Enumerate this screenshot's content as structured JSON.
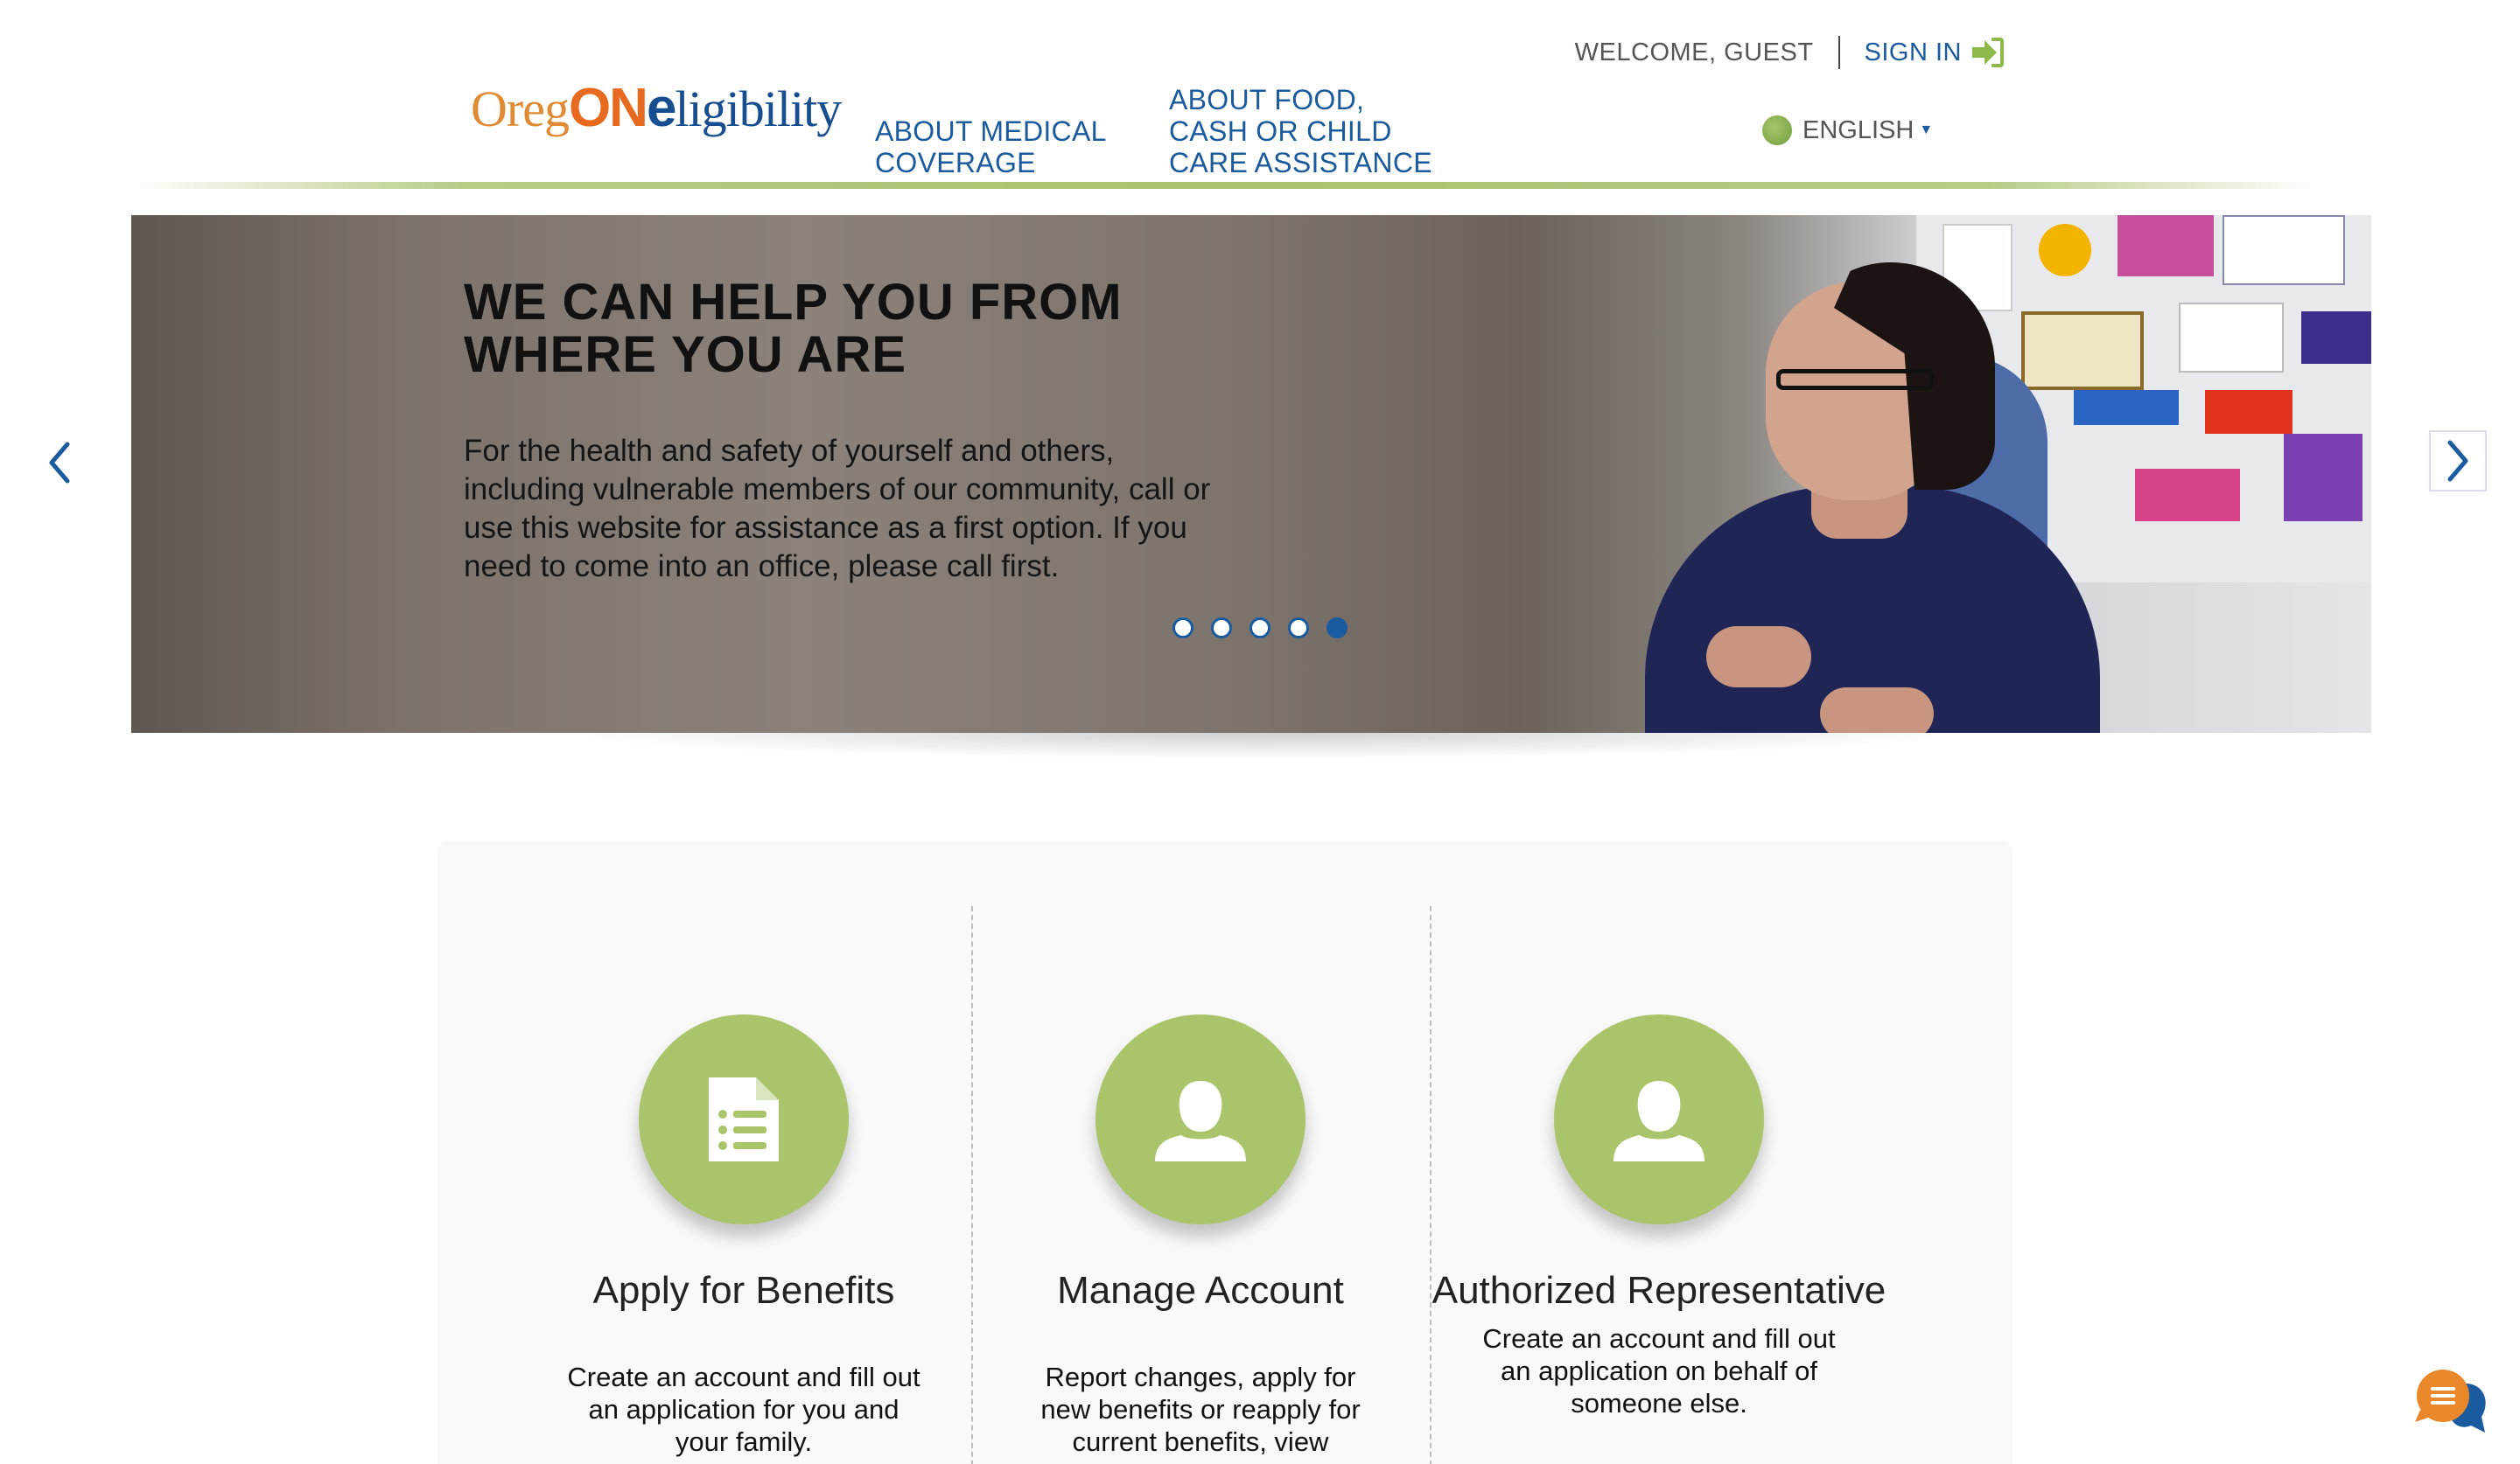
{
  "header": {
    "welcome": "WELCOME, GUEST",
    "signin": "SIGN IN",
    "logo": {
      "part1": "Oreg",
      "part2": "ON",
      "part3": "e",
      "part4": "ligibility"
    },
    "nav": {
      "medical": "ABOUT MEDICAL COVERAGE",
      "food": "ABOUT FOOD, CASH OR CHILD CARE ASSISTANCE"
    },
    "language": "ENGLISH"
  },
  "carousel": {
    "title": "WE CAN HELP YOU FROM WHERE YOU ARE",
    "body": "For the health and safety of yourself and others, including vulnerable members of our community, call or use this website for assistance as a first option. If you need to come into an office, please call first.",
    "slide_count": 5,
    "active_slide": 5
  },
  "features": [
    {
      "title": "Apply for Benefits",
      "desc": "Create an account and fill out an application for you and your family.",
      "icon": "document-list-icon"
    },
    {
      "title": "Manage Account",
      "desc": "Report changes, apply for new benefits or reapply for current benefits, view messages, and",
      "icon": "user-icon"
    },
    {
      "title": "Authorized Representative",
      "desc": "Create an account and fill out an application on behalf of someone else.",
      "icon": "user-icon"
    }
  ],
  "colors": {
    "brand_blue": "#1a5a9e",
    "brand_green": "#a9c46a",
    "brand_orange": "#e86a1f"
  }
}
